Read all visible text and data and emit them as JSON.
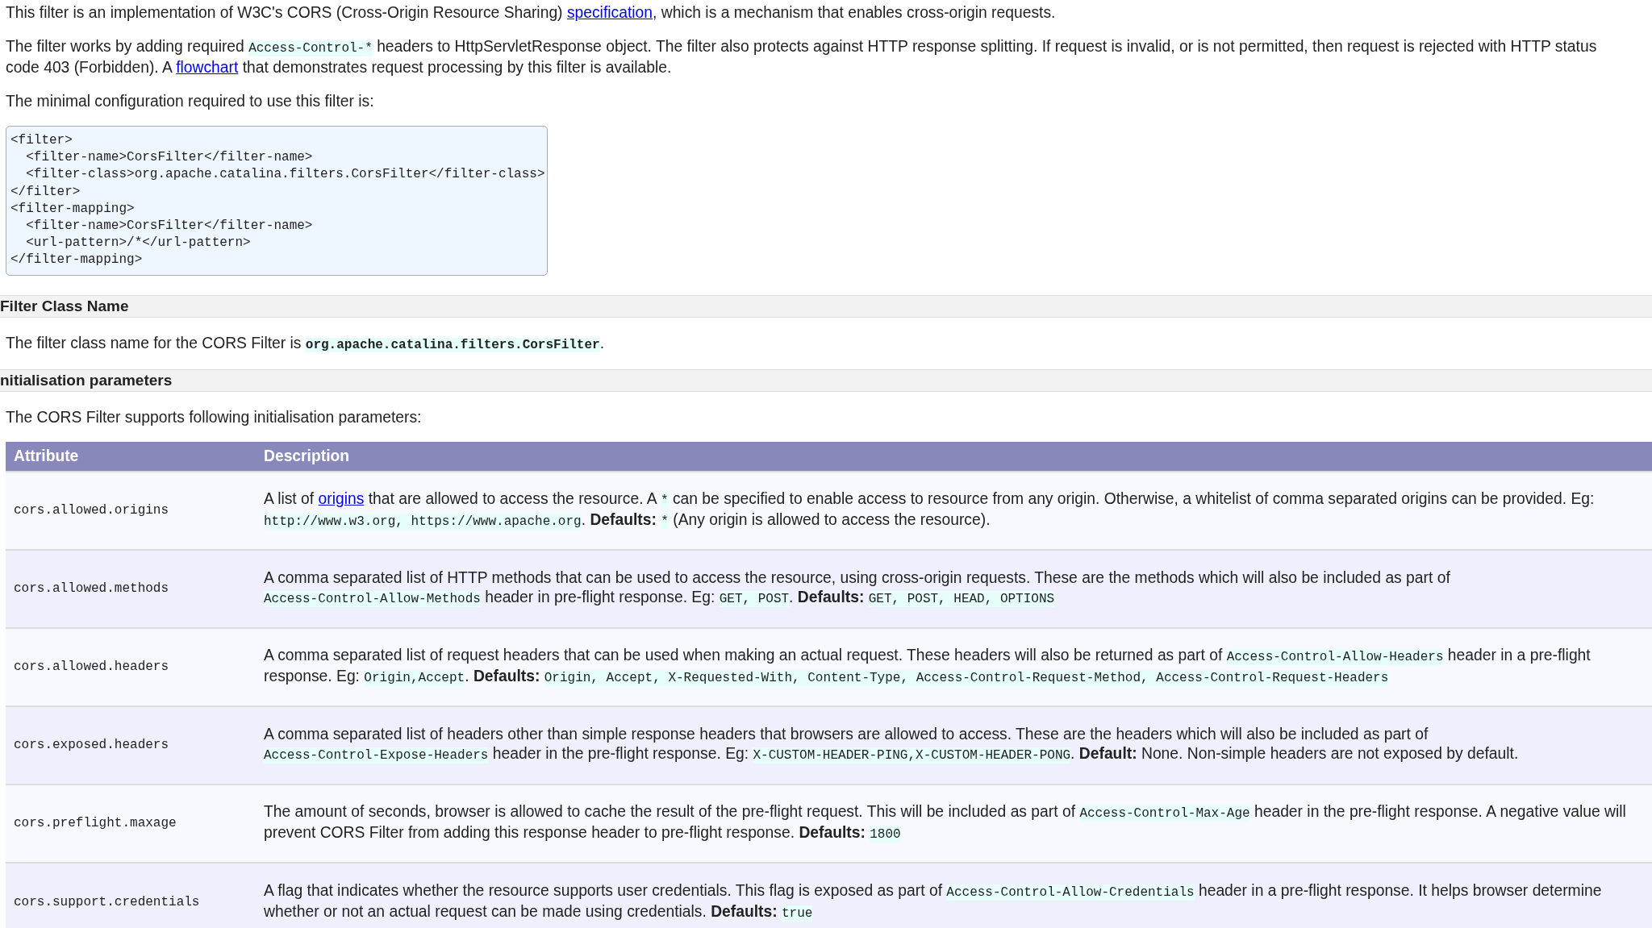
{
  "content": [
    {
      "kind": "paragraph",
      "runs": [
        {
          "kind": "text",
          "text": "This filter is an implementation of W3C's CORS (Cross-Origin Resource Sharing) "
        },
        {
          "kind": "link",
          "text": "specification"
        },
        {
          "kind": "text",
          "text": ", which is a mechanism that enables cross-origin requests."
        }
      ]
    },
    {
      "kind": "paragraph",
      "runs": [
        {
          "kind": "text",
          "text": "The filter works by adding required "
        },
        {
          "kind": "code",
          "text": "Access-Control-*"
        },
        {
          "kind": "text",
          "text": " headers to HttpServletResponse object. The filter also protects against HTTP response splitting. If request is invalid, or is not permitted, then request is rejected with HTTP status code 403 (Forbidden). A "
        },
        {
          "kind": "link",
          "text": "flowchart"
        },
        {
          "kind": "text",
          "text": " that demonstrates request processing by this filter is available."
        }
      ]
    },
    {
      "kind": "paragraph",
      "runs": [
        {
          "kind": "text",
          "text": "The minimal configuration required to use this filter is:"
        }
      ]
    },
    {
      "kind": "code_block",
      "text": "<filter>\n  <filter-name>CorsFilter</filter-name>\n  <filter-class>org.apache.catalina.filters.CorsFilter</filter-class>\n</filter>\n<filter-mapping>\n  <filter-name>CorsFilter</filter-name>\n  <url-pattern>/*</url-pattern>\n</filter-mapping>"
    },
    {
      "kind": "section_heading",
      "text": "Filter Class Name"
    },
    {
      "kind": "paragraph",
      "runs": [
        {
          "kind": "text",
          "text": "The filter class name for the CORS Filter is "
        },
        {
          "kind": "bold_code",
          "text": "org.apache.catalina.filters.CorsFilter"
        },
        {
          "kind": "text",
          "text": "."
        }
      ]
    },
    {
      "kind": "section_heading",
      "text": "nitialisation parameters"
    },
    {
      "kind": "paragraph",
      "runs": [
        {
          "kind": "text",
          "text": "The CORS Filter supports following initialisation parameters:"
        }
      ]
    },
    {
      "kind": "table",
      "columns": [
        "Attribute",
        "Description"
      ],
      "rows": [
        {
          "attribute": "cors.allowed.origins",
          "description": [
            {
              "kind": "text",
              "text": "A list of "
            },
            {
              "kind": "link",
              "text": "origins"
            },
            {
              "kind": "text",
              "text": " that are allowed to access the resource. A "
            },
            {
              "kind": "code",
              "text": "*"
            },
            {
              "kind": "text",
              "text": " can be specified to enable access to resource from any origin. Otherwise, a whitelist of comma separated origins can be provided. Eg: "
            },
            {
              "kind": "code",
              "text": "http://www.w3.org, https://www.apache.org"
            },
            {
              "kind": "text",
              "text": ". "
            },
            {
              "kind": "bold",
              "text": "Defaults: "
            },
            {
              "kind": "code",
              "text": "*"
            },
            {
              "kind": "text",
              "text": " (Any origin is allowed to access the resource)."
            }
          ]
        },
        {
          "attribute": "cors.allowed.methods",
          "description": [
            {
              "kind": "text",
              "text": "A comma separated list of HTTP methods that can be used to access the resource, using cross-origin requests. These are the methods which will also be included as part of "
            },
            {
              "kind": "code",
              "text": "Access-Control-Allow-Methods"
            },
            {
              "kind": "text",
              "text": " header in pre-flight response. Eg: "
            },
            {
              "kind": "code",
              "text": "GET, POST"
            },
            {
              "kind": "text",
              "text": ". "
            },
            {
              "kind": "bold",
              "text": "Defaults: "
            },
            {
              "kind": "code",
              "text": "GET, POST, HEAD, OPTIONS"
            }
          ]
        },
        {
          "attribute": "cors.allowed.headers",
          "description": [
            {
              "kind": "text",
              "text": "A comma separated list of request headers that can be used when making an actual request. These headers will also be returned as part of "
            },
            {
              "kind": "code",
              "text": "Access-Control-Allow-Headers"
            },
            {
              "kind": "text",
              "text": " header in a pre-flight response. Eg: "
            },
            {
              "kind": "code",
              "text": "Origin,Accept"
            },
            {
              "kind": "text",
              "text": ". "
            },
            {
              "kind": "bold",
              "text": "Defaults: "
            },
            {
              "kind": "code",
              "text": "Origin, Accept, X-Requested-With, Content-Type, Access-Control-Request-Method, Access-Control-Request-Headers"
            }
          ]
        },
        {
          "attribute": "cors.exposed.headers",
          "description": [
            {
              "kind": "text",
              "text": "A comma separated list of headers other than simple response headers that browsers are allowed to access. These are the headers which will also be included as part of "
            },
            {
              "kind": "code",
              "text": "Access-Control-Expose-Headers"
            },
            {
              "kind": "text",
              "text": " header in the pre-flight response. Eg: "
            },
            {
              "kind": "code",
              "text": "X-CUSTOM-HEADER-PING,X-CUSTOM-HEADER-PONG"
            },
            {
              "kind": "text",
              "text": ". "
            },
            {
              "kind": "bold",
              "text": "Default:"
            },
            {
              "kind": "text",
              "text": " None. Non-simple headers are not exposed by default."
            }
          ]
        },
        {
          "attribute": "cors.preflight.maxage",
          "description": [
            {
              "kind": "text",
              "text": "The amount of seconds, browser is allowed to cache the result of the pre-flight request. This will be included as part of "
            },
            {
              "kind": "code",
              "text": "Access-Control-Max-Age"
            },
            {
              "kind": "text",
              "text": " header in the pre-flight response. A negative value will prevent CORS Filter from adding this response header to pre-flight response. "
            },
            {
              "kind": "bold",
              "text": "Defaults: "
            },
            {
              "kind": "code",
              "text": "1800"
            }
          ]
        },
        {
          "attribute": "cors.support.credentials",
          "description": [
            {
              "kind": "text",
              "text": "A flag that indicates whether the resource supports user credentials. This flag is exposed as part of "
            },
            {
              "kind": "code",
              "text": "Access-Control-Allow-Credentials"
            },
            {
              "kind": "text",
              "text": " header in a pre-flight response. It helps browser determine whether or not an actual request can be made using credentials. "
            },
            {
              "kind": "bold",
              "text": "Defaults: "
            },
            {
              "kind": "code",
              "text": "true"
            }
          ]
        }
      ]
    }
  ]
}
